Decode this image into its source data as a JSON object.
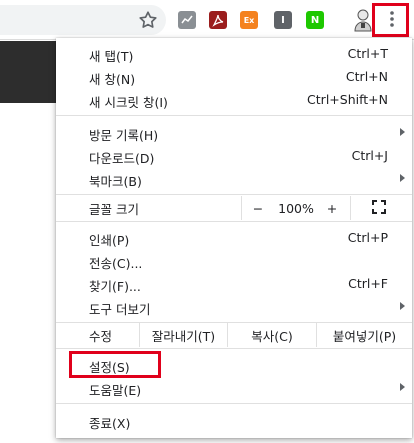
{
  "toolbar": {
    "icons": [
      "star-icon",
      "chart-extension-icon",
      "pdf-extension-icon",
      "orange-extension-icon",
      "gray-extension-icon",
      "naver-extension-icon",
      "avatar-icon",
      "more-vert-icon"
    ],
    "ext_orange_text": "Ex",
    "ext_gray_text": "I",
    "ext_naver_text": "N"
  },
  "menu": {
    "group1": [
      {
        "label": "새 탭(T)",
        "accelerator": "Ctrl+T"
      },
      {
        "label": "새 창(N)",
        "accelerator": "Ctrl+N"
      },
      {
        "label": "새 시크릿 창(I)",
        "accelerator": "Ctrl+Shift+N"
      }
    ],
    "group2": [
      {
        "label": "방문 기록(H)",
        "accelerator": ""
      },
      {
        "label": "다운로드(D)",
        "accelerator": "Ctrl+J"
      },
      {
        "label": "북마크(B)",
        "accelerator": ""
      }
    ],
    "zoom": {
      "label": "글꼴 크기",
      "minus": "−",
      "value": "100%",
      "plus": "+"
    },
    "group3": [
      {
        "label": "인쇄(P)",
        "accelerator": "Ctrl+P"
      },
      {
        "label": "전송(C)...",
        "accelerator": ""
      },
      {
        "label": "찾기(F)...",
        "accelerator": "Ctrl+F"
      },
      {
        "label": "도구 더보기",
        "accelerator": ""
      }
    ],
    "edit": {
      "label": "수정",
      "cut": "잘라내기(T)",
      "copy": "복사(C)",
      "paste": "붙여넣기(P)"
    },
    "group4": [
      {
        "label": "설정(S)",
        "accelerator": ""
      },
      {
        "label": "도움말(E)",
        "accelerator": ""
      }
    ],
    "exit": {
      "label": "종료(X)"
    }
  },
  "colors": {
    "highlight": "#e0001b"
  }
}
